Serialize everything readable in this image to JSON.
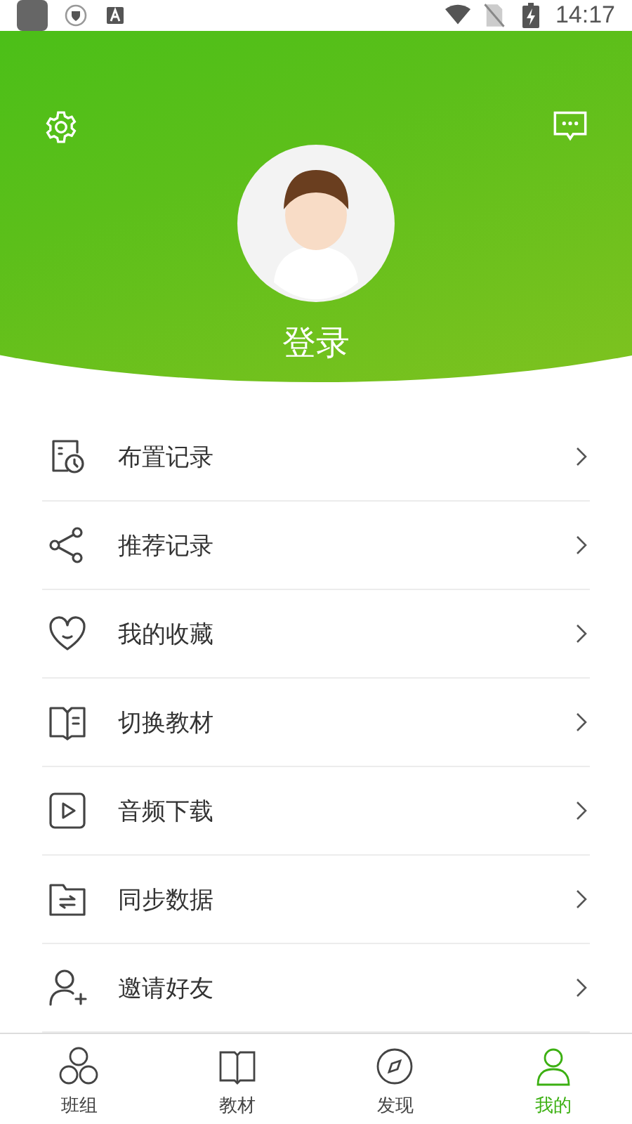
{
  "status_bar": {
    "time": "14:17"
  },
  "profile": {
    "login": "登录"
  },
  "menu": [
    {
      "label": "布置记录"
    },
    {
      "label": "推荐记录"
    },
    {
      "label": "我的收藏"
    },
    {
      "label": "切换教材"
    },
    {
      "label": "音频下载"
    },
    {
      "label": "同步数据"
    },
    {
      "label": "邀请好友"
    }
  ],
  "tabs": [
    {
      "label": "班组",
      "selected": false
    },
    {
      "label": "教材",
      "selected": false
    },
    {
      "label": "发现",
      "selected": false
    },
    {
      "label": "我的",
      "selected": true
    }
  ]
}
